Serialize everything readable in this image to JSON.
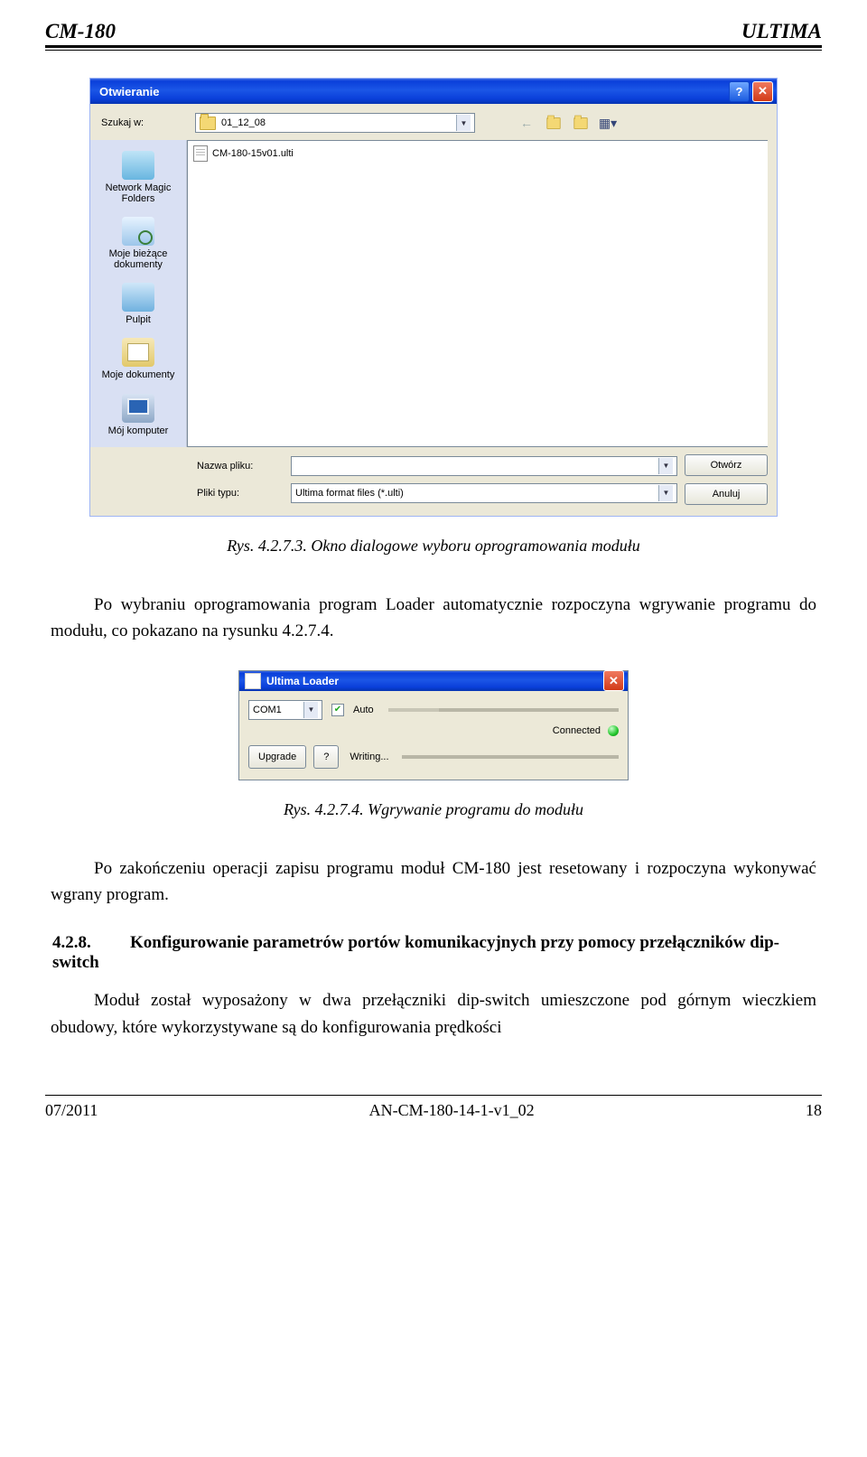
{
  "header": {
    "left": "CM-180",
    "right": "ULTIMA"
  },
  "dialog": {
    "title": "Otwieranie",
    "lookin_label": "Szukaj w:",
    "lookin_value": "01_12_08",
    "file_item": "CM-180-15v01.ulti",
    "places": {
      "nmf": "Network Magic Folders",
      "recent": "Moje bieżące dokumenty",
      "desktop": "Pulpit",
      "mydocs": "Moje dokumenty",
      "mycomp": "Mój komputer"
    },
    "filename_label": "Nazwa pliku:",
    "filename_value": "",
    "filetype_label": "Pliki typu:",
    "filetype_value": "Ultima format files (*.ulti)",
    "open_btn": "Otwórz",
    "cancel_btn": "Anuluj"
  },
  "caption1": "Rys. 4.2.7.3. Okno dialogowe wyboru oprogramowania modułu",
  "para1": "Po wybraniu oprogramowania program Loader automatycznie rozpoczyna wgrywanie programu do modułu, co pokazano na rysunku 4.2.7.4.",
  "loader": {
    "title": "Ultima Loader",
    "com_value": "COM1",
    "auto_label": "Auto",
    "connected": "Connected",
    "upgrade_btn": "Upgrade",
    "help_btn": "?",
    "status": "Writing..."
  },
  "caption2": "Rys. 4.2.7.4. Wgrywanie programu do modułu",
  "para2": "Po zakończeniu operacji zapisu programu moduł CM-180 jest resetowany i rozpoczyna wykonywać wgrany program.",
  "section": {
    "num": "4.2.8.",
    "title": "Konfigurowanie parametrów portów komunikacyjnych przy pomocy przełączników dip-switch"
  },
  "para3": "Moduł został wyposażony w dwa przełączniki dip-switch umieszczone pod górnym wieczkiem obudowy, które wykorzystywane są do konfigurowania prędkości",
  "footer": {
    "left": "07/2011",
    "center": "AN-CM-180-14-1-v1_02",
    "right": "18"
  }
}
